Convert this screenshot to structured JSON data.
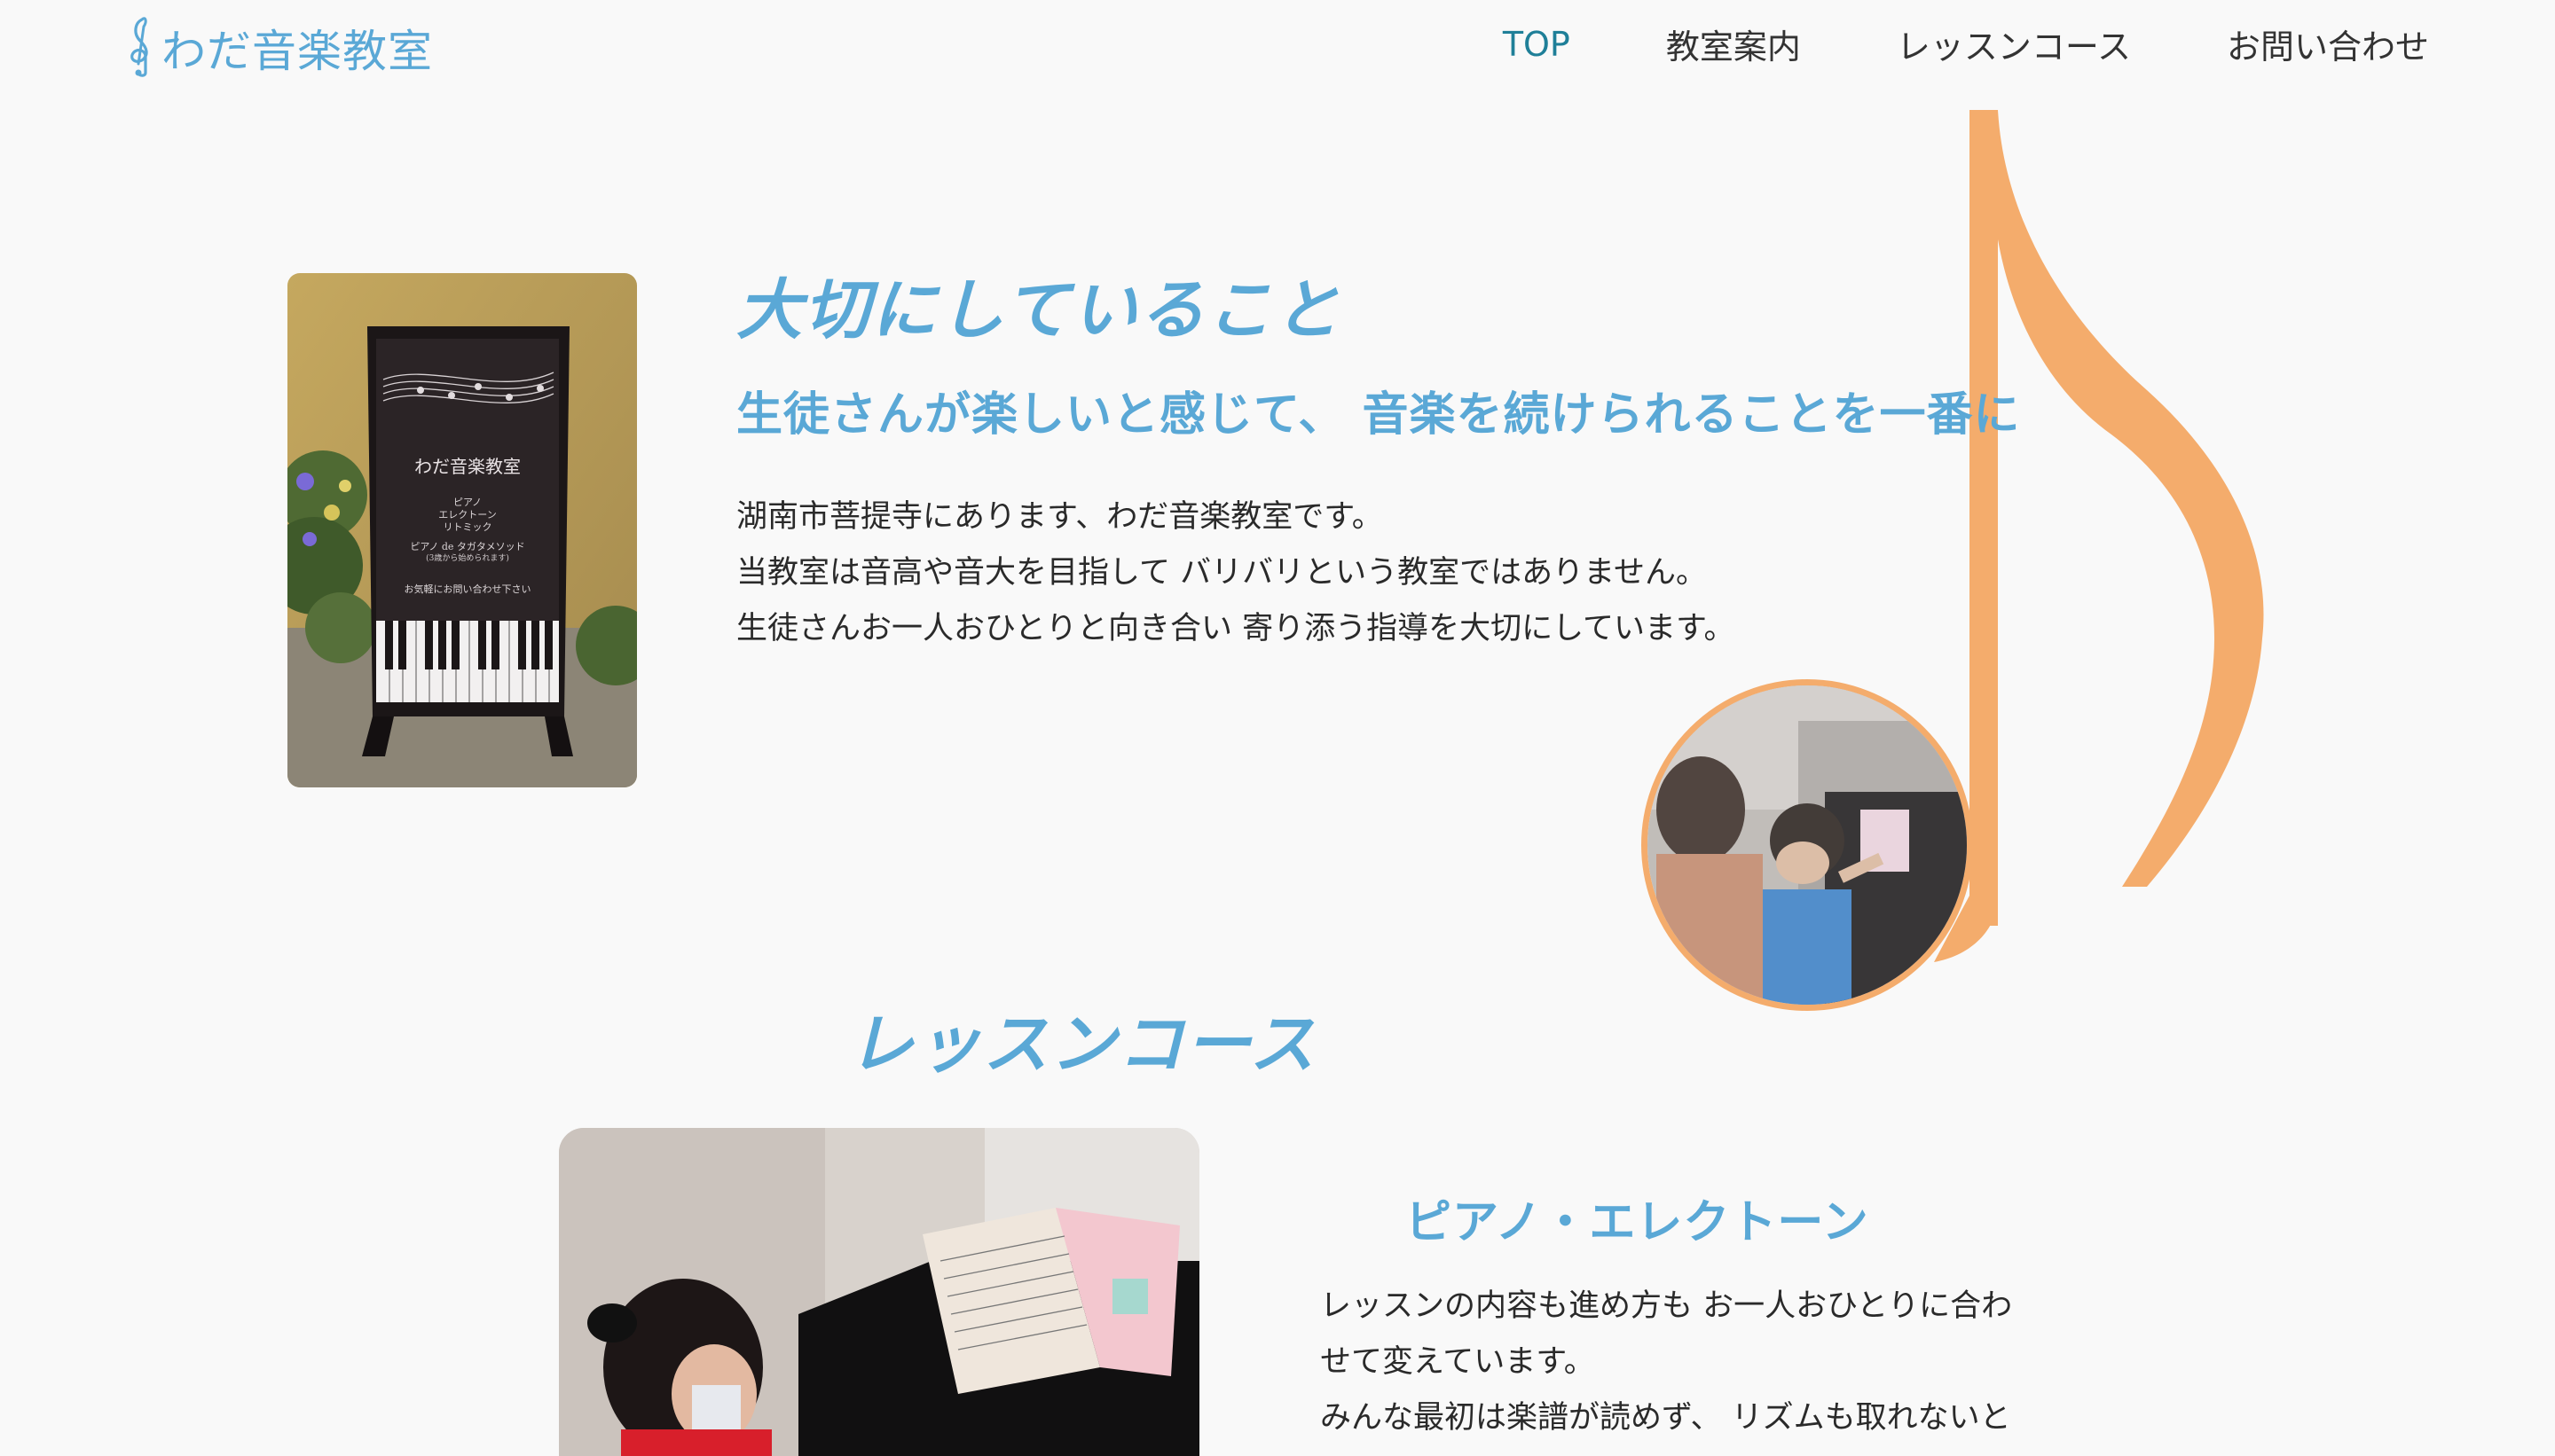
{
  "header": {
    "logo_text": "わだ音楽教室",
    "nav": [
      {
        "label": "TOP",
        "active": true
      },
      {
        "label": "教室案内",
        "active": false
      },
      {
        "label": "レッスンコース",
        "active": false
      },
      {
        "label": "お問い合わせ",
        "active": false
      }
    ]
  },
  "intro": {
    "heading": "大切にしていること",
    "subheading": "生徒さんが楽しいと感じて、 音楽を続けられることを一番に",
    "lines": [
      "湖南市菩提寺にあります、わだ音楽教室です。",
      "当教室は音高や音大を目指して バリバリという教室ではありません。",
      "生徒さんお一人おひとりと向き合い 寄り添う指導を大切にしています。"
    ]
  },
  "sign_photo": {
    "title": "わだ音楽教室",
    "lines": [
      "ピアノ",
      "エレクトーン",
      "リトミック",
      "ピアノ de タガタメソッド",
      "(3歳から始められます)",
      "お気軽にお問い合わせ下さい"
    ]
  },
  "lessons": {
    "heading": "レッスンコース",
    "course_name": "ピアノ・エレクトーン",
    "desc_lines": [
      "レッスンの内容も進め方も お一人おひとりに合わ",
      "せて変えています。",
      "みんな最初は楽譜が読めず、 リズムも取れないと"
    ]
  },
  "colors": {
    "accent_blue": "#5aa8d6",
    "nav_active": "#1f7f98",
    "note_orange": "#f4ac6c",
    "background": "#f9f9f9"
  },
  "icons": {
    "logo": "treble-clef-icon",
    "decoration": "eighth-note-icon"
  }
}
